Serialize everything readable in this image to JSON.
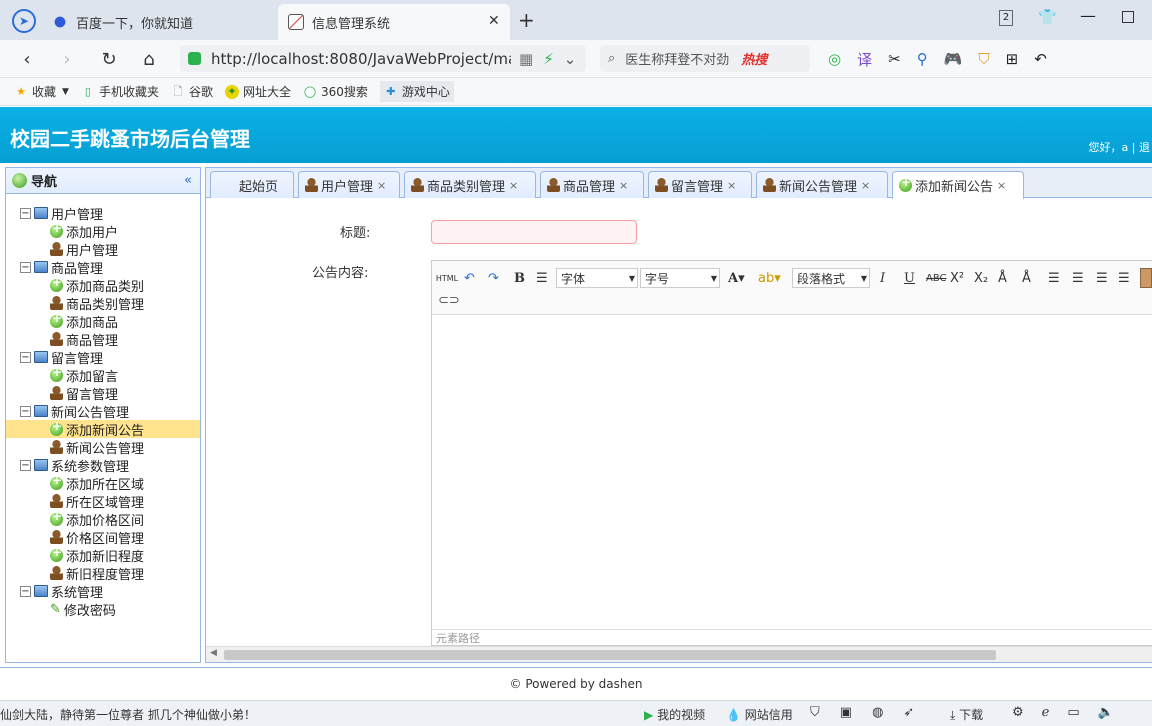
{
  "browser": {
    "tabs": [
      {
        "title": "百度一下，你就知道",
        "active": false
      },
      {
        "title": "信息管理系统",
        "active": true
      }
    ],
    "url": "http://localhost:8080/JavaWebProject/ma",
    "search_text": "医生称拜登不对劲",
    "search_brand": "热搜",
    "bookmarks": [
      "收藏",
      "手机收藏夹",
      "谷歌",
      "网址大全",
      "360搜索",
      "游戏中心"
    ],
    "tab_count": "2"
  },
  "header": {
    "title": "校园二手跳蚤市场后台管理",
    "user_text": "您好，a | 退"
  },
  "nav": {
    "title": "导航",
    "tree": [
      {
        "label": "用户管理",
        "level": 0,
        "icon": "folder"
      },
      {
        "label": "添加用户",
        "level": 1,
        "icon": "add"
      },
      {
        "label": "用户管理",
        "level": 1,
        "icon": "user"
      },
      {
        "label": "商品管理",
        "level": 0,
        "icon": "folder"
      },
      {
        "label": "添加商品类别",
        "level": 1,
        "icon": "add"
      },
      {
        "label": "商品类别管理",
        "level": 1,
        "icon": "user"
      },
      {
        "label": "添加商品",
        "level": 1,
        "icon": "add"
      },
      {
        "label": "商品管理",
        "level": 1,
        "icon": "user"
      },
      {
        "label": "留言管理",
        "level": 0,
        "icon": "folder"
      },
      {
        "label": "添加留言",
        "level": 1,
        "icon": "add"
      },
      {
        "label": "留言管理",
        "level": 1,
        "icon": "user"
      },
      {
        "label": "新闻公告管理",
        "level": 0,
        "icon": "folder"
      },
      {
        "label": "添加新闻公告",
        "level": 1,
        "icon": "add",
        "selected": true
      },
      {
        "label": "新闻公告管理",
        "level": 1,
        "icon": "user"
      },
      {
        "label": "系统参数管理",
        "level": 0,
        "icon": "folder"
      },
      {
        "label": "添加所在区域",
        "level": 1,
        "icon": "add"
      },
      {
        "label": "所在区域管理",
        "level": 1,
        "icon": "user"
      },
      {
        "label": "添加价格区间",
        "level": 1,
        "icon": "add"
      },
      {
        "label": "价格区间管理",
        "level": 1,
        "icon": "user"
      },
      {
        "label": "添加新旧程度",
        "level": 1,
        "icon": "add"
      },
      {
        "label": "新旧程度管理",
        "level": 1,
        "icon": "user"
      },
      {
        "label": "系统管理",
        "level": 0,
        "icon": "folder"
      },
      {
        "label": "修改密码",
        "level": 1,
        "icon": "pencil"
      }
    ]
  },
  "tabs": [
    {
      "label": "起始页",
      "closable": false
    },
    {
      "label": "用户管理",
      "closable": true
    },
    {
      "label": "商品类别管理",
      "closable": true
    },
    {
      "label": "商品管理",
      "closable": true
    },
    {
      "label": "留言管理",
      "closable": true
    },
    {
      "label": "新闻公告管理",
      "closable": true
    },
    {
      "label": "添加新闻公告",
      "closable": true,
      "active": true
    }
  ],
  "form": {
    "title_label": "标题:",
    "title_value": "",
    "content_label": "公告内容:",
    "editor": {
      "font_select": "字体",
      "size_select": "字号",
      "paragraph_select": "段落格式",
      "html_btn": "HTML",
      "status_text": "元素路径"
    }
  },
  "footer": {
    "text": "© Powered by dashen"
  },
  "statusbar": {
    "left_text": "仙剑大陆，静待第一位尊者 抓几个神仙做小弟！",
    "items": [
      "我的视频",
      "网站信用",
      "下载"
    ]
  }
}
